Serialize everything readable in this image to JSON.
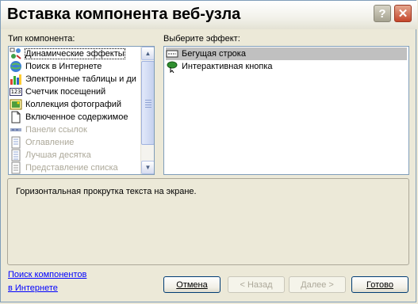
{
  "window": {
    "title": "Вставка компонента веб-узла",
    "help_glyph": "?",
    "close_glyph": "✕"
  },
  "component_type": {
    "label": "Тип компонента:",
    "items": [
      {
        "label": "Динамические эффекты",
        "icon": "dynamic-effects-icon",
        "state": "selected"
      },
      {
        "label": "Поиск в Интернете",
        "icon": "web-search-icon",
        "state": "normal"
      },
      {
        "label": "Электронные таблицы и ди",
        "icon": "spreadsheet-chart-icon",
        "state": "normal"
      },
      {
        "label": "Счетчик посещений",
        "icon": "hit-counter-icon",
        "state": "normal"
      },
      {
        "label": "Коллекция фотографий",
        "icon": "photo-gallery-icon",
        "state": "normal"
      },
      {
        "label": "Включенное содержимое",
        "icon": "included-content-icon",
        "state": "normal"
      },
      {
        "label": "Панели ссылок",
        "icon": "link-bar-icon",
        "state": "disabled"
      },
      {
        "label": "Оглавление",
        "icon": "table-of-contents-icon",
        "state": "disabled"
      },
      {
        "label": "Лучшая десятка",
        "icon": "top-ten-icon",
        "state": "disabled"
      },
      {
        "label": "Представление списка",
        "icon": "list-view-icon",
        "state": "disabled"
      }
    ],
    "counter_icon_text": "123"
  },
  "effect": {
    "label": "Выберите эффект:",
    "items": [
      {
        "label": "Бегущая строка",
        "icon": "marquee-icon",
        "state": "selected"
      },
      {
        "label": "Интерактивная кнопка",
        "icon": "interactive-button-icon",
        "state": "normal"
      }
    ]
  },
  "description": "Горизонтальная прокрутка текста на экране.",
  "find_link": {
    "line1": "Поиск компонентов",
    "line2": "в Интернете"
  },
  "buttons": {
    "cancel": "Отмена",
    "back": "< Назад",
    "next": "Далее >",
    "finish": "Готово"
  }
}
